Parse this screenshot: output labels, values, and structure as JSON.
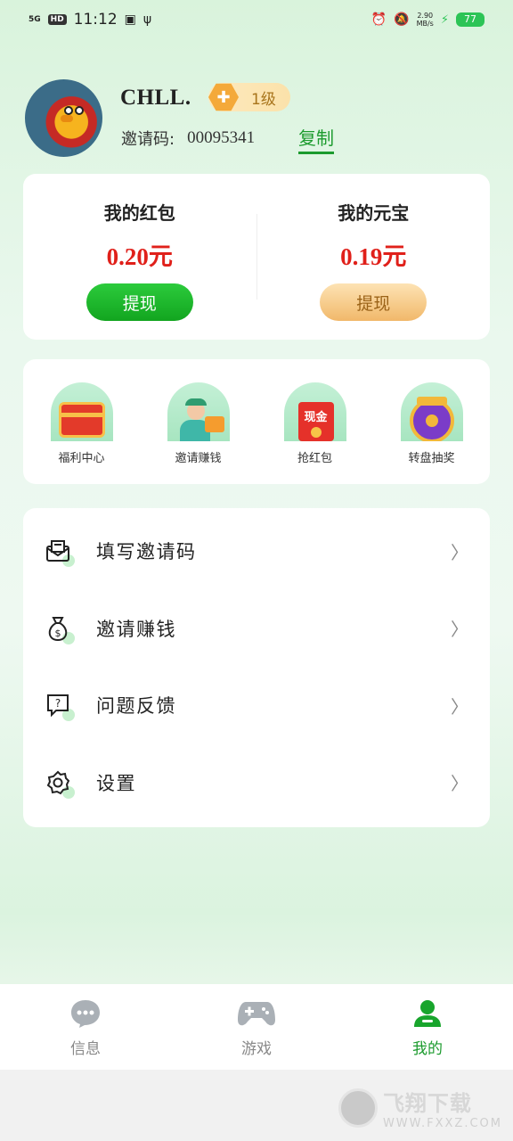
{
  "status_bar": {
    "network": "5G",
    "hd": "HD",
    "time": "11:12",
    "speed_value": "2.90",
    "speed_unit": "MB/s",
    "battery": "77"
  },
  "profile": {
    "username": "CHLL.",
    "level": "1级",
    "invite_label": "邀请码:",
    "invite_code": "00095341",
    "copy_label": "复制"
  },
  "wallet": {
    "red_packet": {
      "title": "我的红包",
      "amount": "0.20元",
      "button": "提现"
    },
    "ingot": {
      "title": "我的元宝",
      "amount": "0.19元",
      "button": "提现"
    }
  },
  "shortcuts": [
    {
      "label": "福利中心",
      "icon": "treasure-chest-icon"
    },
    {
      "label": "邀请赚钱",
      "icon": "delivery-person-icon"
    },
    {
      "label": "抢红包",
      "icon": "red-envelope-icon",
      "tag": "现金"
    },
    {
      "label": "转盘抽奖",
      "icon": "prize-wheel-icon"
    }
  ],
  "menu": [
    {
      "label": "填写邀请码",
      "icon": "mail-icon"
    },
    {
      "label": "邀请赚钱",
      "icon": "money-bag-icon"
    },
    {
      "label": "问题反馈",
      "icon": "feedback-icon"
    },
    {
      "label": "设置",
      "icon": "gear-icon"
    }
  ],
  "tabbar": {
    "tabs": [
      {
        "label": "信息",
        "icon": "chat-bubble-icon",
        "active": false
      },
      {
        "label": "游戏",
        "icon": "gamepad-icon",
        "active": false
      },
      {
        "label": "我的",
        "icon": "user-icon",
        "active": true
      }
    ]
  },
  "watermark": {
    "line1": "飞翔下载",
    "line2": "WWW.FXXZ.COM"
  },
  "colors": {
    "accent_green": "#1c9b2e",
    "amount_red": "#e0201a",
    "gold": "#f1b86a"
  }
}
